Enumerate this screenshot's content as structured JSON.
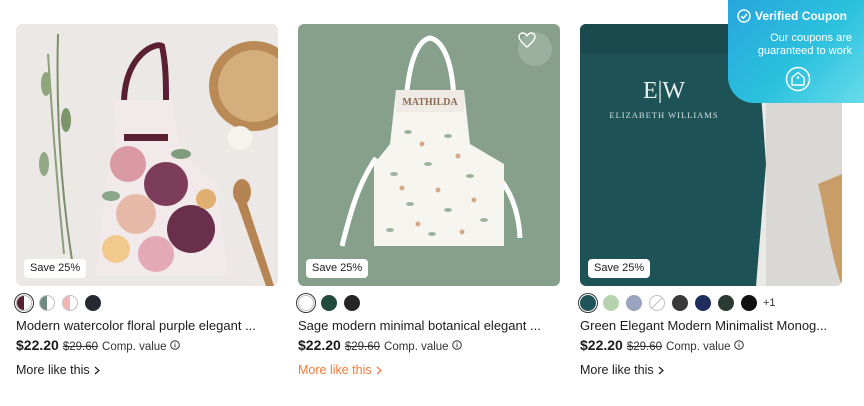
{
  "coupon": {
    "title": "Verified Coupon",
    "subtitle": "Our coupons are guaranteed to work",
    "icons": [
      "check-circle-icon",
      "coupon-tag-icon"
    ]
  },
  "products": [
    {
      "badge": "Save 25%",
      "title": "Modern watercolor floral purple elegant ...",
      "price": "$22.20",
      "original_price": "$29.60",
      "comp_label": "Comp. value",
      "more_link": "More like this",
      "swatches": [
        {
          "kind": "split",
          "left": "#5a1f33",
          "right": "#ffffff",
          "selected": true
        },
        {
          "kind": "split",
          "left": "#6f8a80",
          "right": "#ffffff",
          "selected": false
        },
        {
          "kind": "split",
          "left": "#f2b5b5",
          "right": "#ffffff",
          "selected": false
        },
        {
          "kind": "solid",
          "color": "#252a33",
          "selected": false
        }
      ]
    },
    {
      "badge": "Save 25%",
      "title": "Sage modern minimal botanical elegant ...",
      "price": "$22.20",
      "original_price": "$29.60",
      "comp_label": "Comp. value",
      "more_link": "More like this",
      "more_link_color": "#f47a37",
      "apron_text": "MATHILDA",
      "swatches": [
        {
          "kind": "solid",
          "color": "#ffffff",
          "selected": true
        },
        {
          "kind": "solid",
          "color": "#1f4a3c",
          "selected": false
        },
        {
          "kind": "solid",
          "color": "#252525",
          "selected": false
        }
      ]
    },
    {
      "badge": "Save 25%",
      "title": "Green Elegant Modern Minimalist Monog...",
      "price": "$22.20",
      "original_price": "$29.60",
      "comp_label": "Comp. value",
      "more_link": "More like this",
      "monogram": "E|W",
      "apron_name": "ELIZABETH WILLIAMS",
      "more_colors": "+1",
      "swatches": [
        {
          "kind": "solid",
          "color": "#1f5558",
          "selected": true
        },
        {
          "kind": "solid",
          "color": "#b6d3b0",
          "selected": false
        },
        {
          "kind": "solid",
          "color": "#9aa3bf",
          "selected": false
        },
        {
          "kind": "none",
          "color": "#ffffff",
          "selected": false
        },
        {
          "kind": "solid",
          "color": "#3a3a3a",
          "selected": false
        },
        {
          "kind": "solid",
          "color": "#1f2e5c",
          "selected": false
        },
        {
          "kind": "solid",
          "color": "#2b3a33",
          "selected": false
        },
        {
          "kind": "solid",
          "color": "#111111",
          "selected": false
        }
      ]
    }
  ]
}
